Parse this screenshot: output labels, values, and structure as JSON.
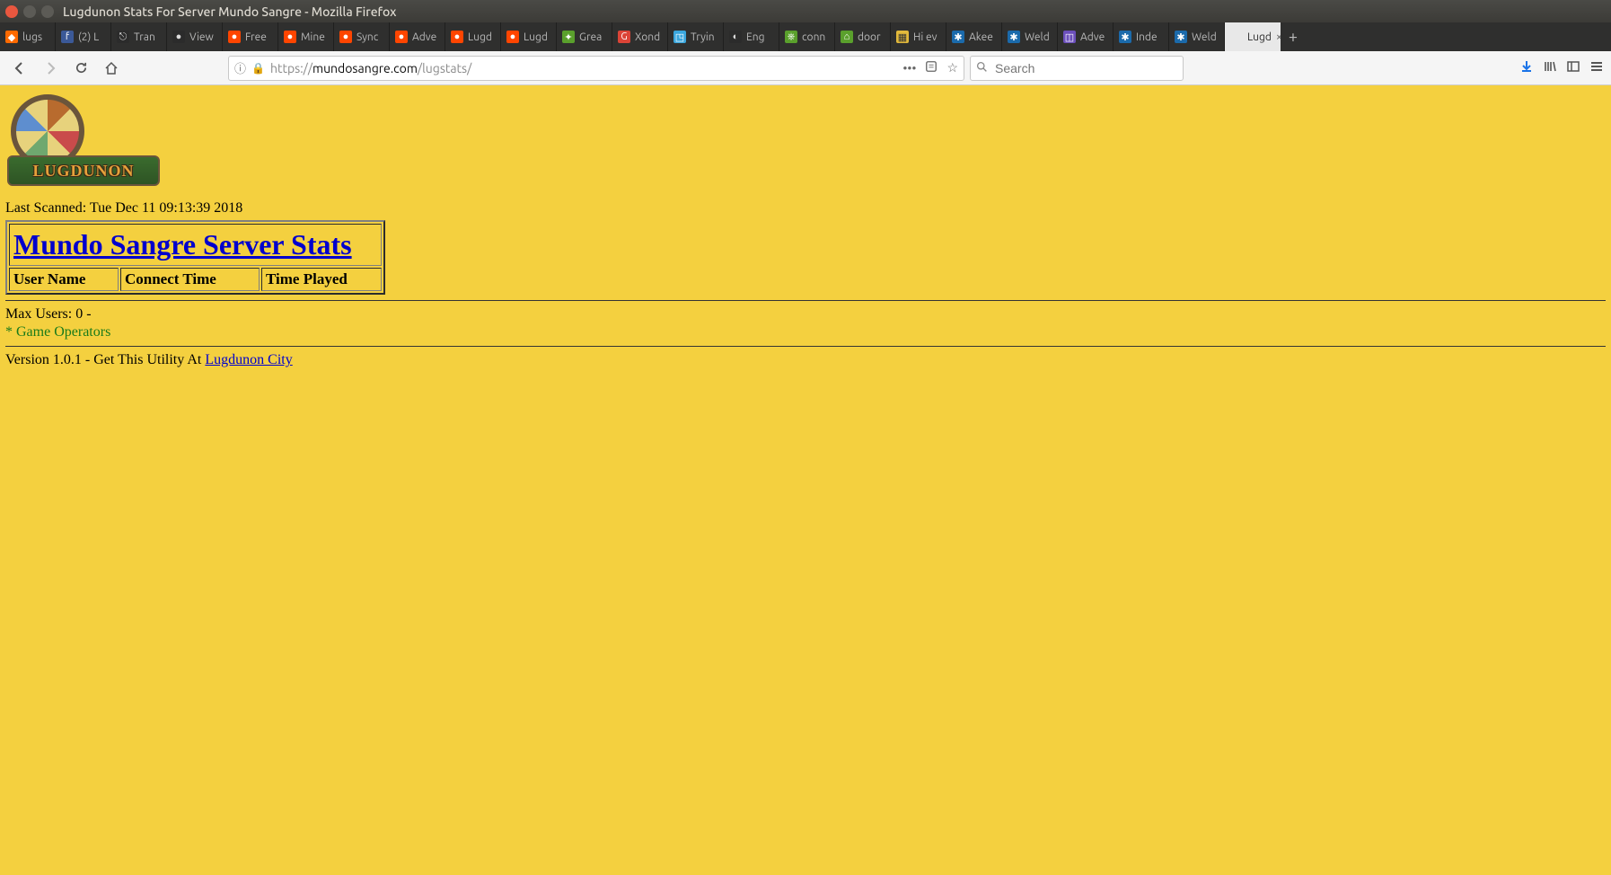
{
  "window": {
    "title": "Lugdunon Stats For Server Mundo Sangre - Mozilla Firefox"
  },
  "tabs": [
    {
      "label": "lugs"
    },
    {
      "label": "(2) L"
    },
    {
      "label": "Tran"
    },
    {
      "label": "View"
    },
    {
      "label": "Free"
    },
    {
      "label": "Mine"
    },
    {
      "label": "Sync"
    },
    {
      "label": "Adve"
    },
    {
      "label": "Lugd"
    },
    {
      "label": "Lugd"
    },
    {
      "label": "Grea"
    },
    {
      "label": "Xond"
    },
    {
      "label": "Tryin"
    },
    {
      "label": "Eng"
    },
    {
      "label": "conn"
    },
    {
      "label": "door"
    },
    {
      "label": "Hi ev"
    },
    {
      "label": "Akee"
    },
    {
      "label": "Weld"
    },
    {
      "label": "Adve"
    },
    {
      "label": "Inde"
    },
    {
      "label": "Weld"
    },
    {
      "label": "Lugd"
    }
  ],
  "navbar": {
    "url_proto": "https://",
    "url_domain": "mundosangre.com",
    "url_path": "/lugstats/",
    "search_placeholder": "Search"
  },
  "page": {
    "logo_text": "LUGDUNON",
    "last_scanned_label": "Last Scanned: ",
    "last_scanned_value": "Tue Dec 11 09:13:39 2018",
    "heading": "Mundo Sangre Server Stats",
    "columns": {
      "user": "User Name",
      "connect": "Connect Time",
      "played": "Time Played"
    },
    "max_users_label": "Max Users: ",
    "max_users_value": "0 -",
    "operators_label": "* Game Operators",
    "version_prefix": "Version 1.0.1 - Get This Utility At ",
    "version_link_text": "Lugdunon City"
  }
}
